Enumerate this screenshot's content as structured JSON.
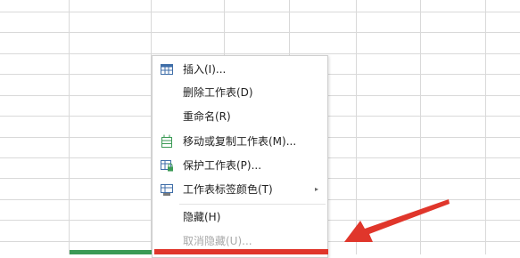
{
  "colors": {
    "grid_line": "#d9d9d9",
    "menu_text": "#222222",
    "disabled_text": "#a9a9a9",
    "icon_blue": "#3f6ea8",
    "icon_green": "#3b9a55",
    "sheet_tab_green": "#3b9a55",
    "highlight_red": "#e0362b"
  },
  "context_menu": {
    "items": [
      {
        "label": "插入(I)...",
        "icon": "insert-table-icon",
        "enabled": true
      },
      {
        "label": "删除工作表(D)",
        "icon": "",
        "enabled": true
      },
      {
        "label": "重命名(R)",
        "icon": "",
        "enabled": true
      },
      {
        "label": "移动或复制工作表(M)...",
        "icon": "move-copy-sheet-icon",
        "enabled": true
      },
      {
        "label": "保护工作表(P)...",
        "icon": "protect-sheet-icon",
        "enabled": true
      },
      {
        "label": "工作表标签颜色(T)",
        "icon": "tab-color-icon",
        "enabled": true,
        "submenu_arrow": "▸"
      },
      {
        "label": "隐藏(H)",
        "icon": "",
        "enabled": true
      },
      {
        "label": "取消隐藏(U)...",
        "icon": "",
        "enabled": false
      }
    ]
  },
  "annotation": {
    "arrow": "red-arrow-icon"
  }
}
